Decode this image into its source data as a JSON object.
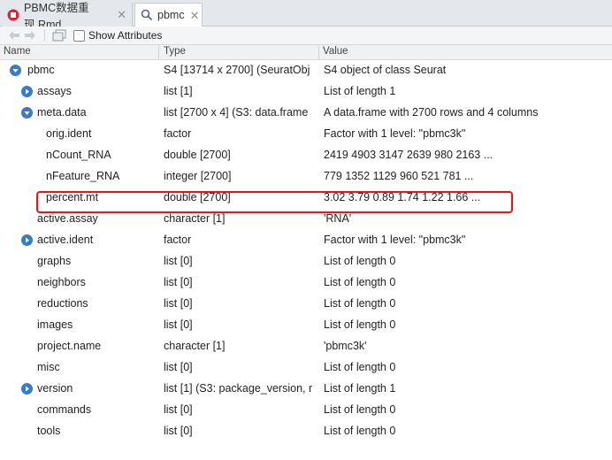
{
  "tabs": [
    {
      "label": "PBMC数据重现.Rmd",
      "icon": "r-markdown-icon"
    },
    {
      "label": "pbmc",
      "icon": "search-icon"
    }
  ],
  "toolbar": {
    "show_attributes_label": "Show Attributes",
    "show_attributes_checked": false
  },
  "columns": {
    "name": "Name",
    "type": "Type",
    "value": "Value"
  },
  "rows": [
    {
      "name": "pbmc",
      "type": "S4 [13714 x 2700] (SeuratObj",
      "value": "S4 object of class Seurat",
      "expander": "expanded"
    },
    {
      "name": "assays",
      "type": "list [1]",
      "value": "List of length 1",
      "expander": "collapsed"
    },
    {
      "name": "meta.data",
      "type": "list [2700 x 4] (S3: data.frame",
      "value": "A data.frame with 2700 rows and 4 columns",
      "expander": "expanded"
    },
    {
      "name": "orig.ident",
      "type": "factor",
      "value": "Factor with 1 level: \"pbmc3k\"",
      "expander": "none"
    },
    {
      "name": "nCount_RNA",
      "type": "double [2700]",
      "value": "2419 4903 3147 2639 980 2163 ...",
      "expander": "none"
    },
    {
      "name": "nFeature_RNA",
      "type": "integer [2700]",
      "value": "779 1352 1129 960 521 781 ...",
      "expander": "none"
    },
    {
      "name": "percent.mt",
      "type": "double [2700]",
      "value": "3.02 3.79 0.89 1.74 1.22 1.66 ...",
      "expander": "none"
    },
    {
      "name": "active.assay",
      "type": "character [1]",
      "value": "'RNA'",
      "expander": "none"
    },
    {
      "name": "active.ident",
      "type": "factor",
      "value": "Factor with 1 level: \"pbmc3k\"",
      "expander": "collapsed"
    },
    {
      "name": "graphs",
      "type": "list [0]",
      "value": "List of length 0",
      "expander": "none"
    },
    {
      "name": "neighbors",
      "type": "list [0]",
      "value": "List of length 0",
      "expander": "none"
    },
    {
      "name": "reductions",
      "type": "list [0]",
      "value": "List of length 0",
      "expander": "none"
    },
    {
      "name": "images",
      "type": "list [0]",
      "value": "List of length 0",
      "expander": "none"
    },
    {
      "name": "project.name",
      "type": "character [1]",
      "value": "'pbmc3k'",
      "expander": "none"
    },
    {
      "name": "misc",
      "type": "list [0]",
      "value": "List of length 0",
      "expander": "none"
    },
    {
      "name": "version",
      "type": "list [1] (S3: package_version, r",
      "value": "List of length 1",
      "expander": "collapsed"
    },
    {
      "name": "commands",
      "type": "list [0]",
      "value": "List of length 0",
      "expander": "none"
    },
    {
      "name": "tools",
      "type": "list [0]",
      "value": "List of length 0",
      "expander": "none"
    }
  ],
  "highlighted_row": "percent.mt",
  "colors": {
    "expander": "#3b7bbf",
    "highlight": "#e8131b"
  }
}
